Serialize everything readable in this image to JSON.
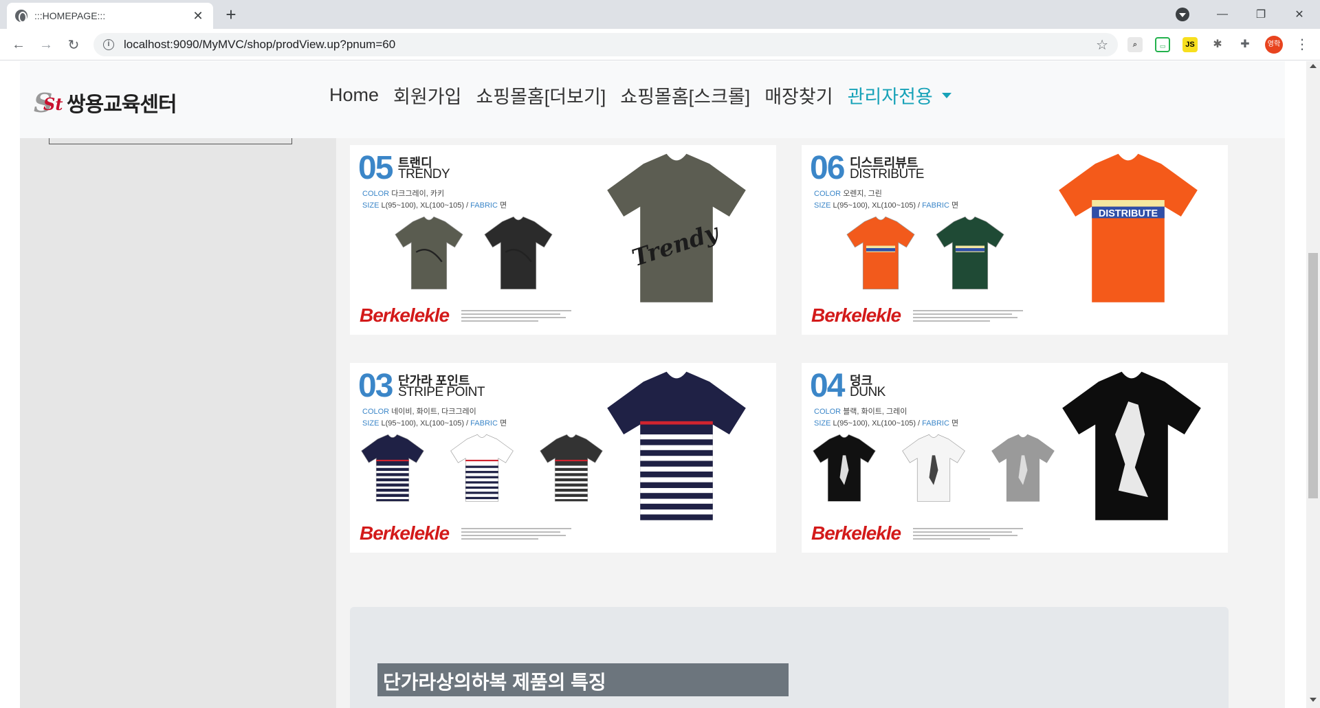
{
  "browser": {
    "tab_title": ":::HOMEPAGE:::",
    "tab_close": "✕",
    "new_tab": "+",
    "url": "localhost:9090/MyMVC/shop/prodView.up?pnum=60",
    "avatar_text": "영학",
    "extensions": [
      "JS"
    ],
    "window_controls": {
      "minimize": "—",
      "restore": "❐",
      "close": "✕"
    },
    "nav": {
      "back": "←",
      "forward": "→",
      "reload": "↻"
    }
  },
  "site": {
    "logo_text": "쌍용교육센터",
    "logo_mark_1": "S",
    "logo_mark_2": "St",
    "menu": [
      "Home",
      "회원가입",
      "쇼핑몰홈[더보기]",
      "쇼핑몰홈[스크롤]",
      "매장찾기",
      "관리자전용"
    ]
  },
  "products": [
    {
      "num": "05",
      "ko": "트랜디",
      "en": "TRENDY",
      "color_label": "COLOR",
      "color": "다크그레이, 카키",
      "size_label": "SIZE",
      "size": "L(95~100), XL(100~105) /",
      "fabric_label": "FABRIC",
      "fabric": "면",
      "brand": "Berkelekle",
      "print": "Trendy",
      "colors": [
        "#5a5c50",
        "#2b2b2b"
      ],
      "main": "#5c5d52"
    },
    {
      "num": "06",
      "ko": "디스트리뷰트",
      "en": "DISTRIBUTE",
      "color_label": "COLOR",
      "color": "오렌지, 그린",
      "size_label": "SIZE",
      "size": "L(95~100), XL(100~105) /",
      "fabric_label": "FABRIC",
      "fabric": "면",
      "brand": "Berkelekle",
      "print": "DISTRIBUTE",
      "colors": [
        "#f25a1c",
        "#1f4a35"
      ],
      "main": "#f45a1a"
    },
    {
      "num": "03",
      "ko": "단가라 포인트",
      "en": "STRIPE POINT",
      "color_label": "COLOR",
      "color": "네이비, 화이트, 다크그레이",
      "size_label": "SIZE",
      "size": "L(95~100), XL(100~105) /",
      "fabric_label": "FABRIC",
      "fabric": "면",
      "brand": "Berkelekle",
      "print": "",
      "colors": [
        "#1f2145",
        "#ffffff",
        "#333333"
      ],
      "main": "#1f2145"
    },
    {
      "num": "04",
      "ko": "덩크",
      "en": "DUNK",
      "color_label": "COLOR",
      "color": "블랙, 화이트, 그레이",
      "size_label": "SIZE",
      "size": "L(95~100), XL(100~105) /",
      "fabric_label": "FABRIC",
      "fabric": "면",
      "brand": "Berkelekle",
      "print": "",
      "colors": [
        "#111111",
        "#f5f5f5",
        "#9a9a9a"
      ],
      "main": "#0d0d0d"
    }
  ],
  "feature_title": "단가라상의하복 제품의 특징"
}
